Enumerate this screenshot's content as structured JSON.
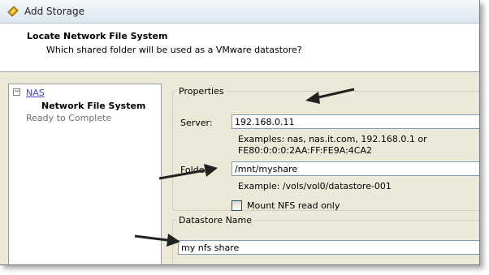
{
  "window": {
    "title": "Add Storage"
  },
  "header": {
    "title": "Locate Network File System",
    "subtitle": "Which shared folder will be used as a VMware datastore?"
  },
  "sidebar": {
    "toggle": "−",
    "items": [
      {
        "label": "NAS",
        "state": "link"
      },
      {
        "label": "Network File System",
        "state": "current"
      },
      {
        "label": "Ready to Complete",
        "state": "pending"
      }
    ]
  },
  "properties": {
    "legend": "Properties",
    "server_label": "Server:",
    "server_value": "192.168.0.11",
    "server_hint_line1": "Examples: nas, nas.it.com, 192.168.0.1 or",
    "server_hint_line2": "FE80:0:0:0:2AA:FF:FE9A:4CA2",
    "folder_label": "Folder:",
    "folder_value": "/mnt/myshare",
    "folder_hint": "Example: /vols/vol0/datastore-001",
    "readonly_label": "Mount NFS read only",
    "readonly_checked": false
  },
  "datastore": {
    "legend": "Datastore Name",
    "name_value": "my nfs share"
  },
  "annotation_color": "#222222",
  "accent_link_color": "#4949c9"
}
